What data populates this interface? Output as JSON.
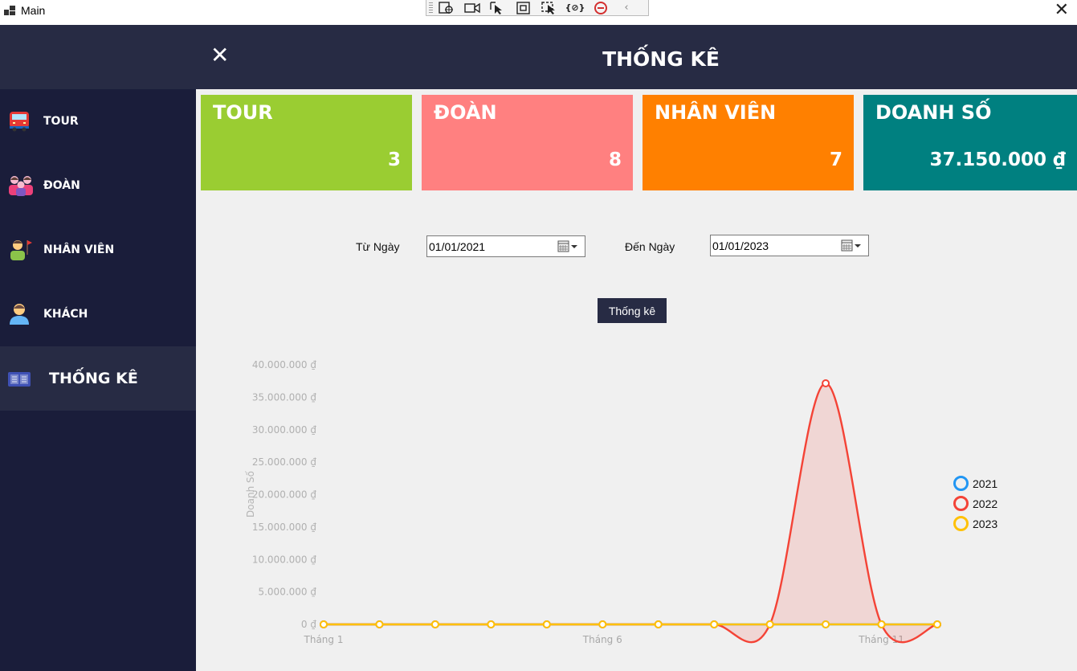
{
  "window": {
    "title": "Main",
    "close_glyph": "✕"
  },
  "header": {
    "title": "THỐNG KÊ",
    "close_glyph": "✕"
  },
  "sidebar": {
    "items": [
      {
        "label": "TOUR",
        "icon": "bus-icon"
      },
      {
        "label": "ĐOÀN",
        "icon": "group-icon"
      },
      {
        "label": "NHÂN VIÊN",
        "icon": "staff-icon"
      },
      {
        "label": "KHÁCH",
        "icon": "customer-icon"
      },
      {
        "label": "THỐNG KÊ",
        "icon": "statistics-icon",
        "active": true
      }
    ]
  },
  "cards": [
    {
      "title": "TOUR",
      "value": "3",
      "color": "#9acd32"
    },
    {
      "title": "ĐOÀN",
      "value": "8",
      "color": "#ff8080"
    },
    {
      "title": "NHÂN VIÊN",
      "value": "7",
      "color": "#ff8000"
    },
    {
      "title": "DOANH SỐ",
      "value": "37.150.000 ₫",
      "color": "#008080"
    }
  ],
  "filter": {
    "from_label": "Từ Ngày",
    "from_value": "01/01/2021",
    "to_label": "Đến Ngày",
    "to_value": "01/01/2023",
    "button": "Thống kê"
  },
  "chart_data": {
    "type": "line",
    "ylabel": "Doanh Số",
    "ylim": [
      0,
      40000000
    ],
    "y_ticks": [
      "0 ₫",
      "5.000.000 ₫",
      "10.000.000 ₫",
      "15.000.000 ₫",
      "20.000.000 ₫",
      "25.000.000 ₫",
      "30.000.000 ₫",
      "35.000.000 ₫",
      "40.000.000 ₫"
    ],
    "x_tick_labels": [
      "Tháng 1",
      "Tháng 6",
      "Tháng 11"
    ],
    "x": [
      1,
      2,
      3,
      4,
      5,
      6,
      7,
      8,
      9,
      10,
      11,
      12
    ],
    "series": [
      {
        "name": "2021",
        "color": "#2196f3",
        "values": [
          0,
          0,
          0,
          0,
          0,
          0,
          0,
          0,
          0,
          0,
          0,
          0
        ]
      },
      {
        "name": "2022",
        "color": "#f44336",
        "values": [
          0,
          0,
          0,
          0,
          0,
          0,
          0,
          0,
          0,
          37150000,
          0,
          0
        ]
      },
      {
        "name": "2023",
        "color": "#ffc107",
        "values": [
          0,
          0,
          0,
          0,
          0,
          0,
          0,
          0,
          0,
          0,
          0,
          0
        ]
      }
    ],
    "legend_position": "right",
    "grid": false
  }
}
